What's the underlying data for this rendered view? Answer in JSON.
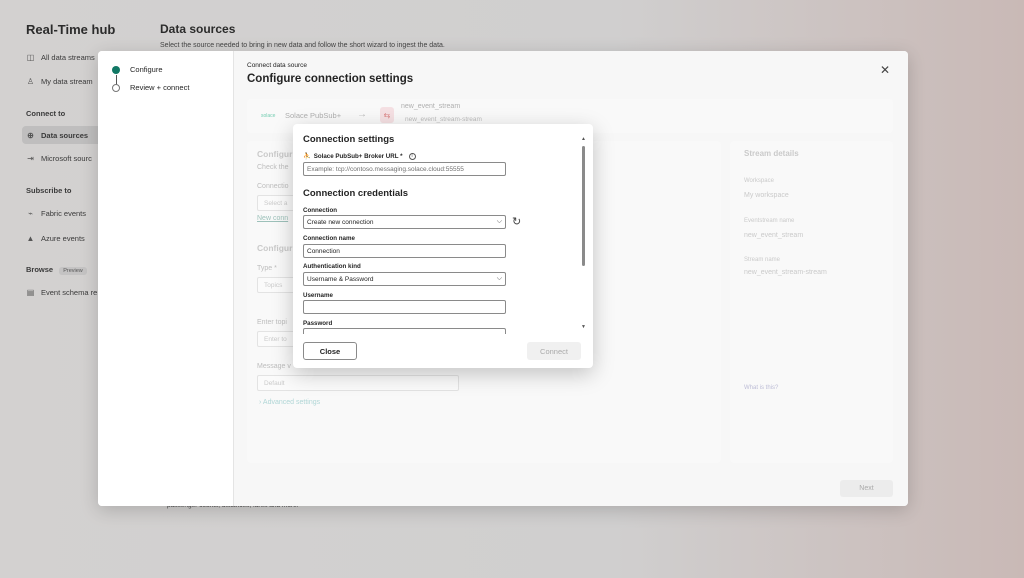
{
  "background": {
    "hub_title": "Real-Time hub",
    "heading": "Data sources",
    "subheading": "Select the source needed to bring in new data and follow the short wizard to ingest the data.",
    "sidebar": {
      "top_items": [
        {
          "label": "All data streams",
          "icon": "stream-icon"
        },
        {
          "label": "My data stream",
          "icon": "person-icon"
        }
      ],
      "connect_to": "Connect to",
      "connect_items": [
        {
          "label": "Data sources",
          "icon": "plus-circle-icon"
        },
        {
          "label": "Microsoft sourc",
          "icon": "arrow-in-icon"
        }
      ],
      "subscribe_to": "Subscribe to",
      "subscribe_items": [
        {
          "label": "Fabric events",
          "icon": "event-icon"
        },
        {
          "label": "Azure events",
          "icon": "azure-icon"
        }
      ],
      "browse": "Browse",
      "browse_badge": "Preview",
      "browse_items": [
        {
          "label": "Event schema re",
          "icon": "schema-icon"
        }
      ]
    },
    "footer_text": "passenger counts, distances, fares and more."
  },
  "wizard": {
    "steps": [
      "Configure",
      "Review + connect"
    ],
    "breadcrumb": "Connect data source",
    "title": "Configure connection settings",
    "source_bar": {
      "source_logo": "solace",
      "source_name": "Solace PubSub+",
      "eventstream_name": "new_event_stream",
      "stream_name": "new_event_stream-stream"
    },
    "form": {
      "configure_head": "Configur",
      "check_text": "Check the",
      "connection_label": "Connectio",
      "connection_placeholder": "Select a",
      "new_connection_link": "New conn",
      "configure_head2": "Configur",
      "type_label": "Type *",
      "type_value": "Topics",
      "topic_label": "Enter topi",
      "topic_placeholder": "Enter to",
      "message_label": "Message v",
      "message_value": "Default",
      "advanced": "Advanced settings"
    },
    "details": {
      "title": "Stream details",
      "workspace_label": "Workspace",
      "workspace_value": "My workspace",
      "eventstream_label": "Eventstream name",
      "eventstream_value": "new_event_stream",
      "stream_label": "Stream name",
      "stream_value": "new_event_stream-stream",
      "what_link": "What is this?"
    },
    "next_label": "Next"
  },
  "connection_dialog": {
    "settings_heading": "Connection settings",
    "broker_url_label": "Solace PubSub+ Broker URL *",
    "broker_url_placeholder": "Example: tcp://contoso.messaging.solace.cloud:55555",
    "credentials_heading": "Connection credentials",
    "connection_label": "Connection",
    "connection_value": "Create new connection",
    "connection_name_label": "Connection name",
    "connection_name_value": "Connection",
    "auth_kind_label": "Authentication kind",
    "auth_kind_value": "Username & Password",
    "username_label": "Username",
    "username_value": "",
    "password_label": "Password",
    "close_label": "Close",
    "connect_label": "Connect"
  },
  "colors": {
    "accent": "#117865",
    "overlay": "#cfcccb"
  }
}
